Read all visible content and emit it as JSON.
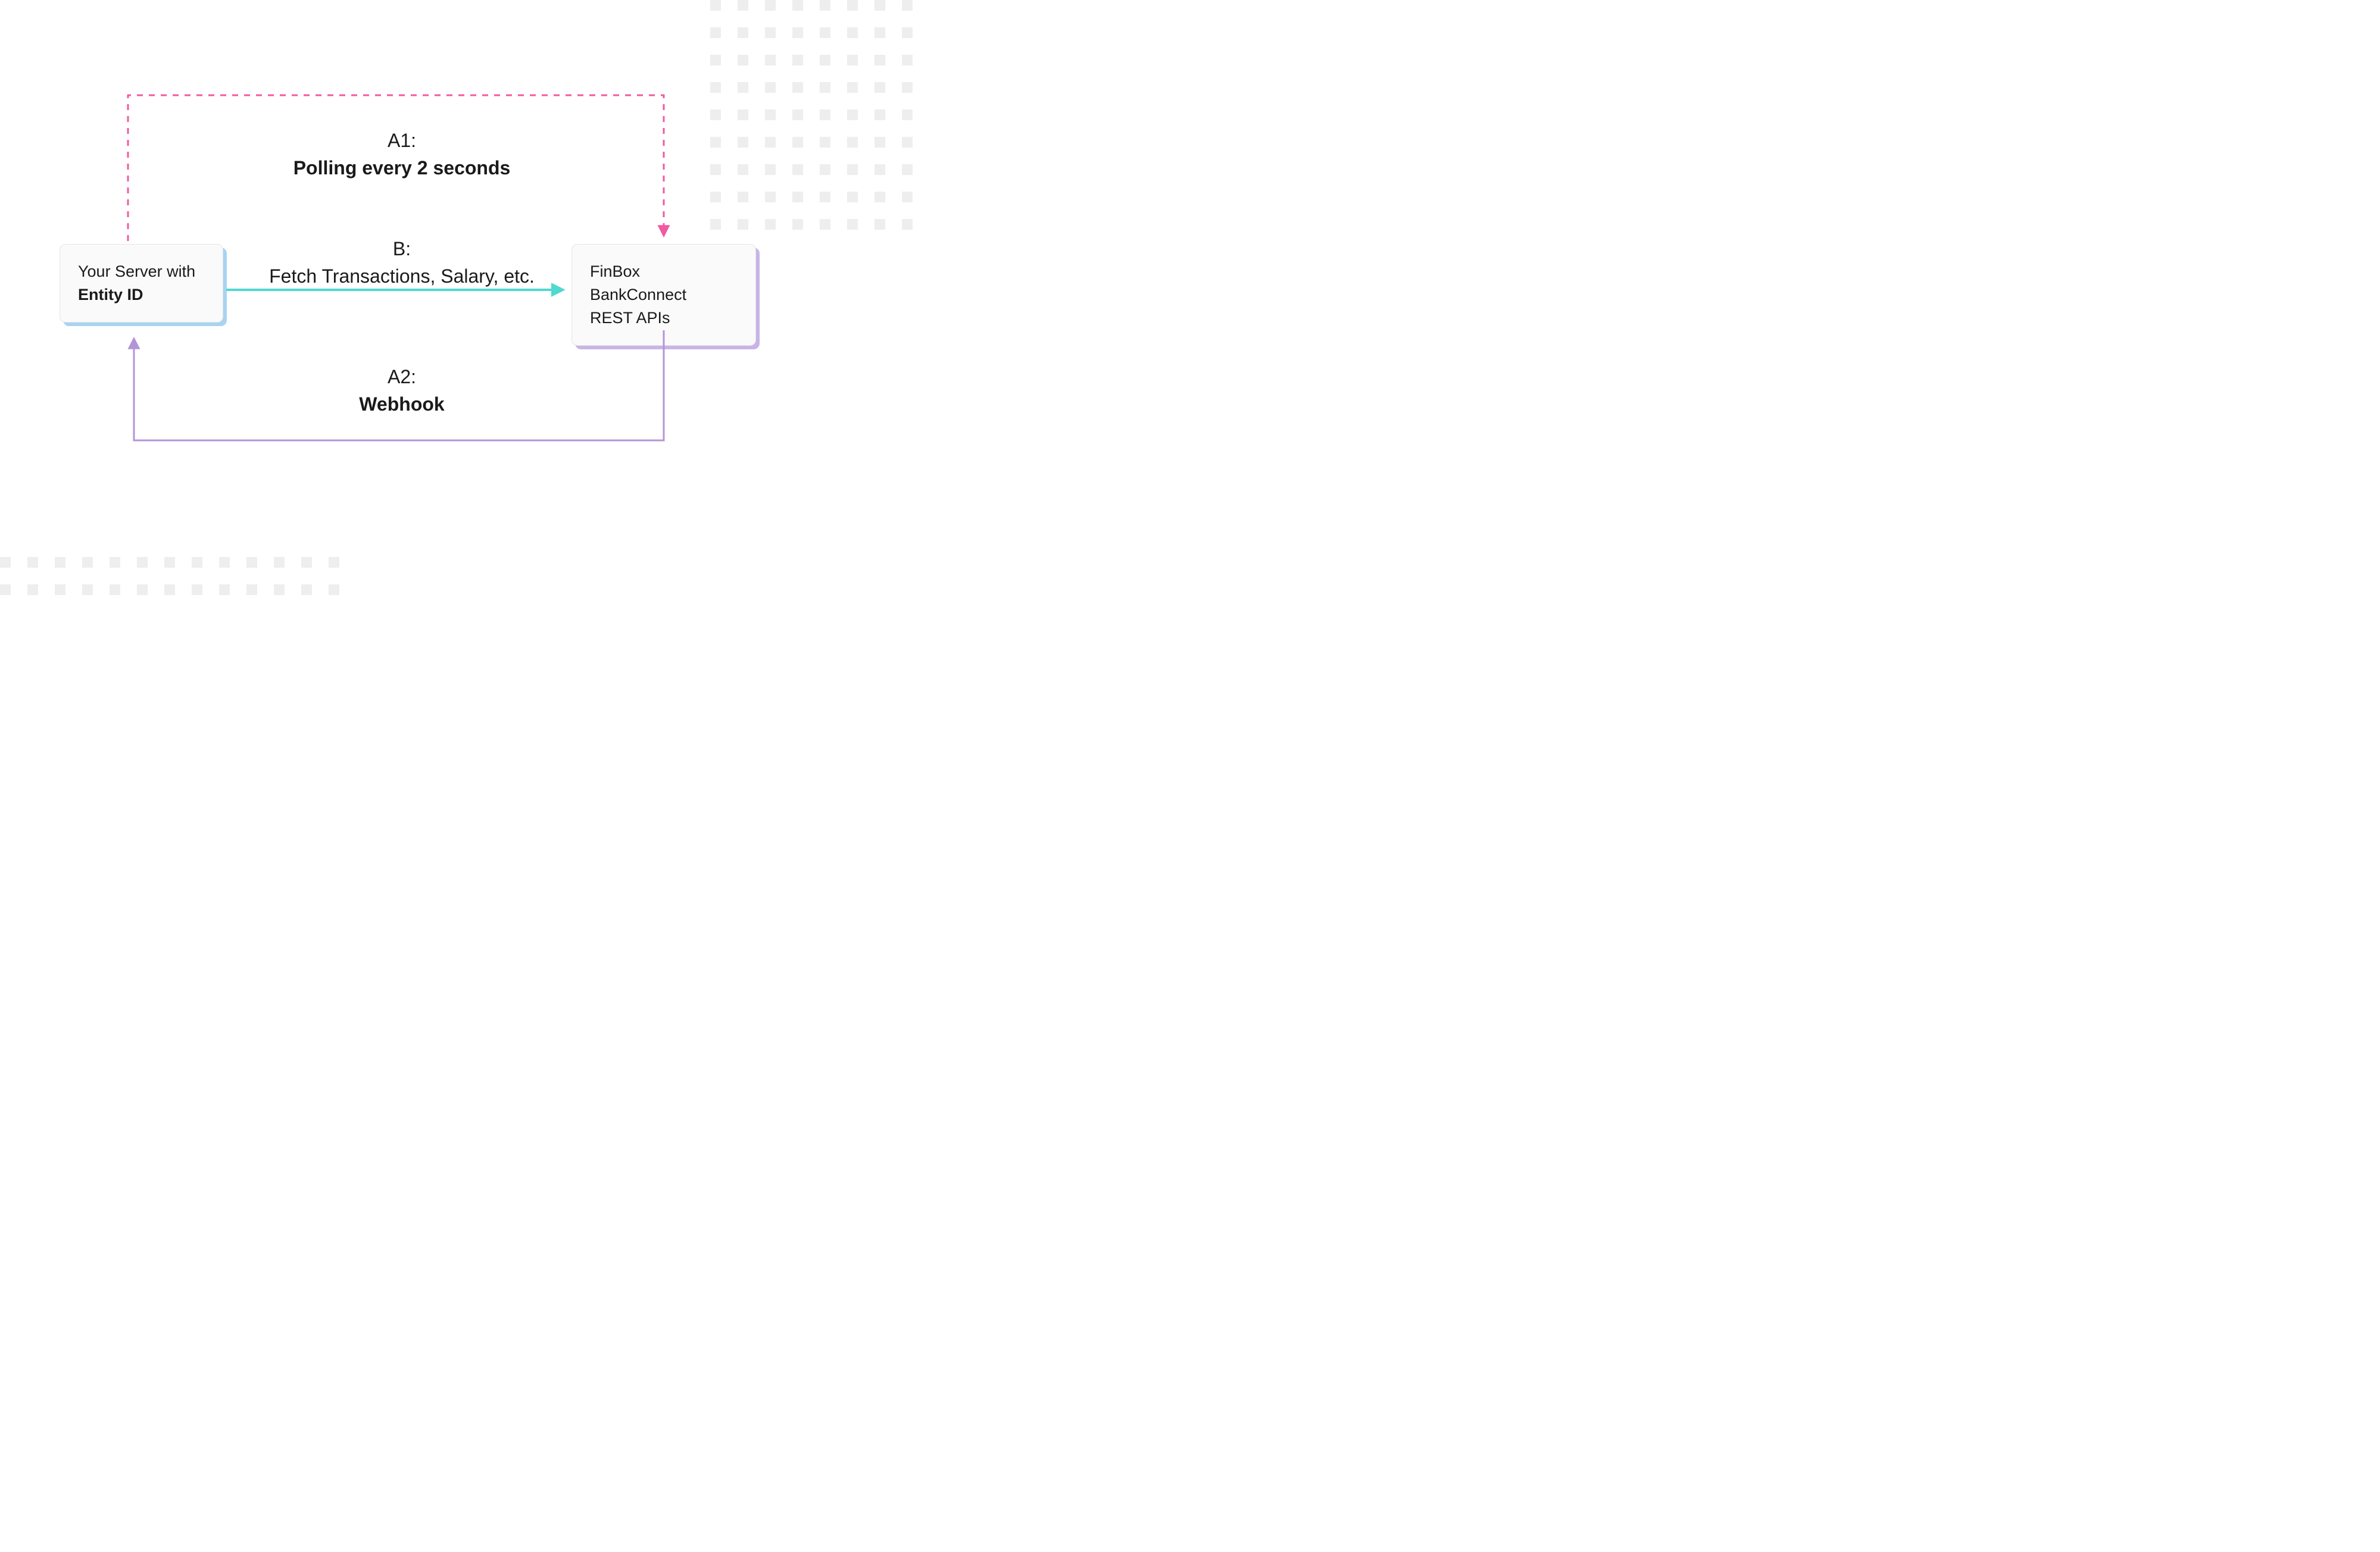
{
  "nodes": {
    "left": {
      "line1": "Your Server with",
      "line2_bold": "Entity ID"
    },
    "right": {
      "line1": "FinBox BankConnect",
      "line2": "REST APIs"
    }
  },
  "labels": {
    "a1": {
      "tag": "A1:",
      "text": "Polling every 2 seconds"
    },
    "b": {
      "tag": "B:",
      "text": "Fetch Transactions, Salary, etc."
    },
    "a2": {
      "tag": "A2:",
      "text": "Webhook"
    }
  },
  "colors": {
    "pink": "#f15aa0",
    "teal": "#4fd9d0",
    "purple": "#b295d9",
    "nodeLeftShadow": "#a9d3f2",
    "nodeRightShadow": "#c8b4e6"
  }
}
